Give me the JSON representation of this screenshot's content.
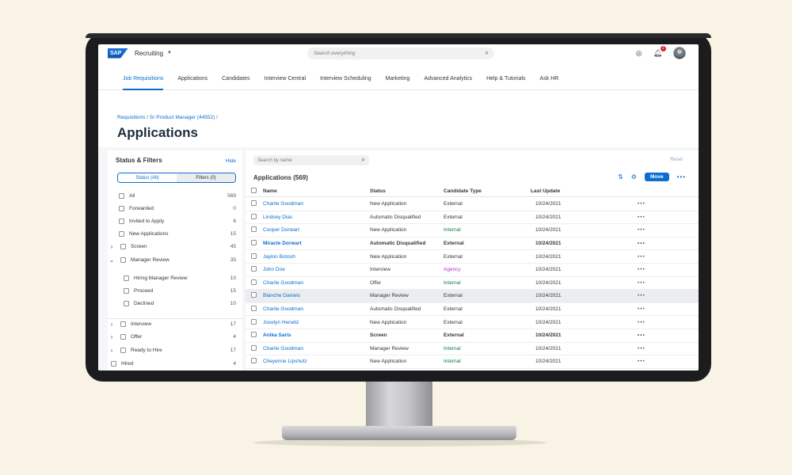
{
  "shell": {
    "logo_text": "SAP",
    "app_name": "Recruiting",
    "search_placeholder": "Search everything",
    "notification_count": "2"
  },
  "nav": {
    "items": [
      "Job Requisitions",
      "Applications",
      "Candidates",
      "Interview Central",
      "Interview Scheduling",
      "Marketing",
      "Advanced Analytics",
      "Help & Tutorials",
      "Ask HR"
    ],
    "active": "Job Requisitions"
  },
  "header": {
    "breadcrumb": [
      "Requisitions",
      "Sr Product Manager (44552)"
    ],
    "title": "Applications"
  },
  "filters": {
    "title": "Status & Filters",
    "hide_label": "Hide",
    "tab_status": "Status (All)",
    "tab_filters": "Filters (0)",
    "items": [
      {
        "label": "All",
        "count": "569"
      },
      {
        "label": "Forwarded",
        "count": "0"
      },
      {
        "label": "Invited to Apply",
        "count": "6"
      },
      {
        "label": "New Applications",
        "count": "15"
      },
      {
        "label": "Screen",
        "count": "45"
      },
      {
        "label": "Manager Review",
        "count": "35"
      },
      {
        "label": "Hiring Manager Review",
        "count": "10"
      },
      {
        "label": "Proceed",
        "count": "15"
      },
      {
        "label": "Declined",
        "count": "10"
      },
      {
        "label": "Interview",
        "count": "17"
      },
      {
        "label": "Offer",
        "count": "4"
      },
      {
        "label": "Ready to Hire",
        "count": "17"
      },
      {
        "label": "Hired",
        "count": "4"
      }
    ]
  },
  "table": {
    "search_placeholder": "Search by name",
    "reset_label": "Reset",
    "title": "Applications (569)",
    "move_label": "Move",
    "more_label": "•••",
    "columns": [
      "Name",
      "Status",
      "Candidate Type",
      "Last Update"
    ],
    "rows": [
      {
        "name": "Charlie Goodman",
        "status": "New Application",
        "type": "External",
        "date": "10/24/2021"
      },
      {
        "name": "Lindsey Dias",
        "status": "Automatic Disqualified",
        "type": "External",
        "date": "10/24/2021"
      },
      {
        "name": "Cooper Dorwart",
        "status": "New Application",
        "type": "Internal",
        "date": "10/24/2021"
      },
      {
        "name": "Miracle Dorwart",
        "status": "Automatic Disqualified",
        "type": "External",
        "date": "10/24/2021"
      },
      {
        "name": "Jaylon Botosh",
        "status": "New Application",
        "type": "External",
        "date": "10/24/2021"
      },
      {
        "name": "John Doe",
        "status": "Interview",
        "type": "Agency",
        "date": "10/24/2021"
      },
      {
        "name": "Charlie Goodman",
        "status": "Offer",
        "type": "Internal",
        "date": "10/24/2021"
      },
      {
        "name": "Blanche Daniels",
        "status": "Manager Review",
        "type": "External",
        "date": "10/24/2021"
      },
      {
        "name": "Charlie Goodman",
        "status": "Automatic Disqualified",
        "type": "External",
        "date": "10/24/2021"
      },
      {
        "name": "Jocelyn Herwitz",
        "status": "New Application",
        "type": "External",
        "date": "10/24/2021"
      },
      {
        "name": "Anika Saris",
        "status": "Screen",
        "type": "External",
        "date": "10/24/2021"
      },
      {
        "name": "Charlie Goodman",
        "status": "Manager Review",
        "type": "Internal",
        "date": "10/24/2021"
      },
      {
        "name": "Cheyenne Lipshutz",
        "status": "New Application",
        "type": "Internal",
        "date": "10/24/2021"
      }
    ]
  },
  "colors": {
    "accent": "#0a6ed1",
    "internal": "#107e3e",
    "agency": "#b33ac9",
    "background": "#f8f3e4"
  }
}
